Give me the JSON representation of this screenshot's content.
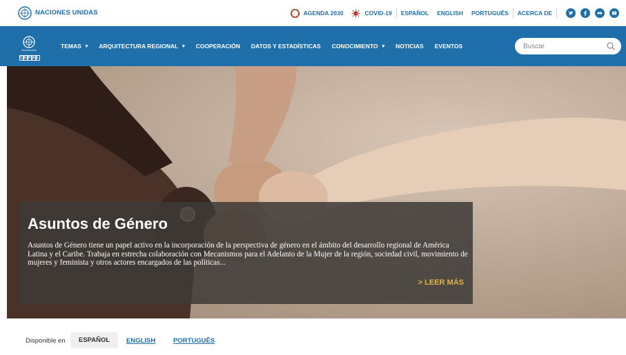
{
  "topbar": {
    "org_name": "NACIONES UNIDAS",
    "links": [
      {
        "label": "AGENDA 2030",
        "icon": "sdg-wheel-icon"
      },
      {
        "label": "COVID-19",
        "icon": "virus-icon"
      },
      {
        "label": "ESPAÑOL"
      },
      {
        "label": "ENGLISH"
      },
      {
        "label": "PORTUGUÊS"
      },
      {
        "label": "ACERCA DE"
      }
    ],
    "social": [
      "twitter-icon",
      "facebook-icon",
      "flickr-icon",
      "youtube-icon"
    ]
  },
  "navbar": {
    "logo_text": [
      "C",
      "E",
      "P",
      "A",
      "L"
    ],
    "items": [
      {
        "label": "TEMAS",
        "dropdown": true
      },
      {
        "label": "ARQUITECTURA REGIONAL",
        "dropdown": true
      },
      {
        "label": "COOPERACIÓN",
        "dropdown": false
      },
      {
        "label": "DATOS Y ESTADÍSTICAS",
        "dropdown": false
      },
      {
        "label": "CONOCIMIENTO",
        "dropdown": true
      },
      {
        "label": "NOTICIAS",
        "dropdown": false
      },
      {
        "label": "EVENTOS",
        "dropdown": false
      }
    ],
    "search_placeholder": "Buscar"
  },
  "hero": {
    "title": "Asuntos de Género",
    "description": "Asuntos de Género tiene un papel activo en la incorporación de la perspectiva de género en el ámbito del desarrollo regional de América Latina y el Caribe. Trabaja en estrecha colaboración con Mecanismos para el Adelanto de la Mujer de la región, sociedad civil, movimiento de mujeres y feminista y otros actores encargados de las políticas...",
    "read_more": "> LEER MÁS"
  },
  "language": {
    "label": "Disponible en",
    "active": "ESPAÑOL",
    "others": [
      "ENGLISH",
      "PORTUGUÊS"
    ]
  },
  "colors": {
    "brand_blue": "#1e6faa",
    "accent_gold": "#e3b34a"
  }
}
